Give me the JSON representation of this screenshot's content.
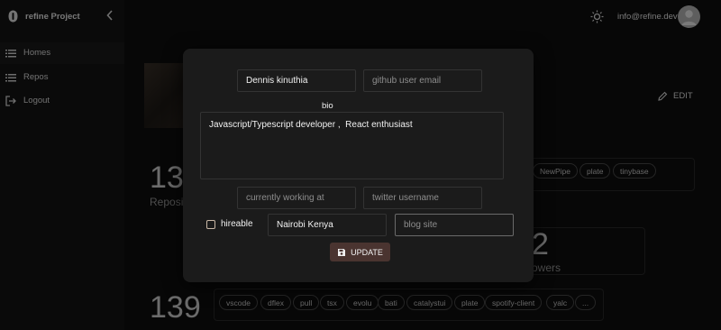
{
  "brand": {
    "name": "refine Project"
  },
  "sidebar": {
    "items": [
      {
        "label": "Homes",
        "icon": "list-icon",
        "active": true
      },
      {
        "label": "Repos",
        "icon": "list-icon",
        "active": false
      },
      {
        "label": "Logout",
        "icon": "logout-icon",
        "active": false
      }
    ]
  },
  "header": {
    "email": "info@refine.dev",
    "theme_icon": "sun-icon",
    "avatar_icon": "person-icon"
  },
  "page": {
    "edit_label": "EDIT",
    "repos_count": "13",
    "repos_label": "Reposi",
    "followers_count": "2",
    "followers_label": "owers",
    "starred_count": "139",
    "top_chips": [
      "NewPipe",
      "plate",
      "tinybase"
    ],
    "bottom_chips": [
      "vscode",
      "dflex",
      "pull",
      "tsx",
      "evolu",
      "bati",
      "catalystui",
      "plate",
      "spotify-client",
      "yalc",
      "..."
    ]
  },
  "form": {
    "name_value": "Dennis kinuthia",
    "email_placeholder": "github user email",
    "bio_label": "bio",
    "bio_value": "Javascript/Typescript developer ,  React enthusiast",
    "company_placeholder": "currently working at",
    "twitter_placeholder": "twitter username",
    "hireable_label": "hireable",
    "hireable_checked": false,
    "location_value": "Nairobi Kenya",
    "blog_placeholder": "blog site",
    "update_label": "UPDATE"
  },
  "colors": {
    "background": "#0e0e0e",
    "modal": "#1b1b1b",
    "update_button": "#4a3430",
    "checkbox": "#c9b8a6"
  }
}
